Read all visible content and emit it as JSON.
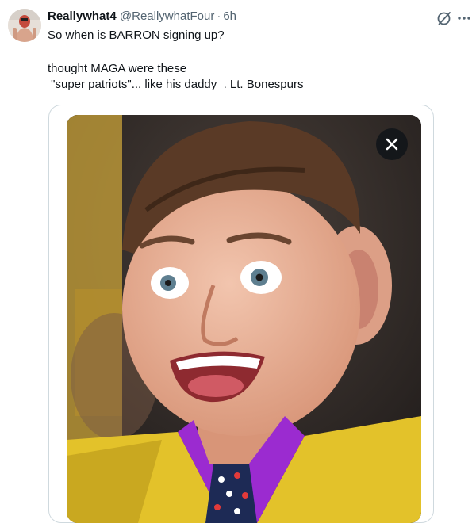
{
  "tweet": {
    "display_name": "Reallywhat4",
    "handle": "@ReallywhatFour",
    "separator": "·",
    "time": "6h",
    "lines": [
      "So when is BARRON signing up?",
      "",
      "thought MAGA were these",
      " \"super patriots\"... like his daddy  . Lt. Bonespurs"
    ]
  },
  "icons": {
    "avatar": "user-avatar",
    "grok": "grok-icon",
    "more": "more-icon",
    "close": "close-icon"
  },
  "colors": {
    "text_primary": "#0f1419",
    "text_secondary": "#536471",
    "border": "#cfd9de",
    "suit_yellow": "#e3c22a",
    "shirt_purple": "#9b2bd0"
  }
}
